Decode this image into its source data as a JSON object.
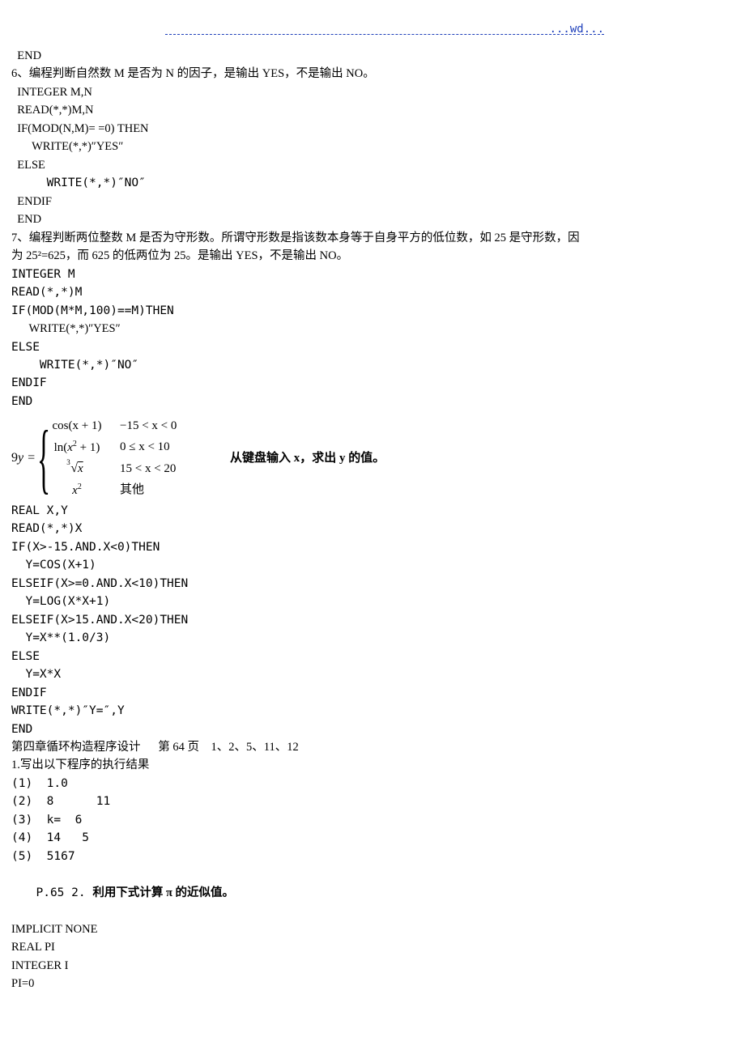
{
  "header": {
    "wd": "...wd..."
  },
  "line_end1": "  END",
  "q6_title": "6、编程判断自然数 M 是否为 N 的因子，是输出 YES，不是输出 NO。",
  "q6_l1": "  INTEGER M,N",
  "q6_l2": "  READ(*,*)M,N",
  "q6_l3": "  IF(MOD(N,M)= =0) THEN",
  "q6_l4": "       WRITE(*,*)″YES″",
  "q6_l5": "  ELSE",
  "q6_l6": "     WRITE(*,*)″NO″",
  "q6_l7": "  ENDIF",
  "q6_l8": "  END",
  "q7_title_a": "7、编程判断两位整数 M 是否为守形数。所谓守形数是指该数本身等于自身平方的低位数，如 25 是守形数，因",
  "q7_title_b": "为 25²=625，而 625 的低两位为 25。是输出 YES，不是输出 NO。",
  "q7_l1": "INTEGER M",
  "q7_l2": "READ(*,*)M",
  "q7_l3": "IF(MOD(M*M,100)==M)THEN",
  "q7_l4": "      WRITE(*,*)″YES″",
  "q7_l5": "ELSE",
  "q7_l6": "    WRITE(*,*)″NO″",
  "q7_l7": "ENDIF",
  "q7_l8": "END",
  "q9_label": "9 ",
  "q9_y_eq": "y = ",
  "piecewise": {
    "r1c1": "cos(x + 1)",
    "r1c2": "−15 < x < 0",
    "r2c1": "ln(x² + 1)",
    "r2c2": "0 ≤ x < 10",
    "r3_root_index": "3",
    "r3_root_arg": "x",
    "r3c2": "15 < x < 20",
    "r4c1": "x²",
    "r4c2": "其他"
  },
  "q9_prompt_a": "从键盘输入 ",
  "q9_prompt_x": "x",
  "q9_prompt_b": "，求出 ",
  "q9_prompt_y": "y",
  "q9_prompt_c": " 的值。",
  "q9_l1": "REAL X,Y",
  "q9_l2": "READ(*,*)X",
  "q9_l3": "IF(X>-15.AND.X<0)THEN",
  "q9_l4": "  Y=COS(X+1)",
  "q9_l5": "ELSEIF(X>=0.AND.X<10)THEN",
  "q9_l6": "  Y=LOG(X*X+1)",
  "q9_l7": "ELSEIF(X>15.AND.X<20)THEN",
  "q9_l8": "  Y=X**(1.0/3)",
  "q9_l9": "ELSE",
  "q9_l10": "  Y=X*X",
  "q9_l11": "ENDIF",
  "q9_l12": "WRITE(*,*)″Y=″,Y",
  "q9_l13": "END",
  "ch4_title": "第四章循环构造程序设计      第 64 页    1、2、5、11、12",
  "ch4_q1": "1.写出以下程序的执行结果",
  "ch4_r1": "(1)  1.0",
  "ch4_r2": "(2)  8      11",
  "ch4_r3": "(3)  k=  6",
  "ch4_r4": "(4)  14   5",
  "ch4_r5": "(5)  5167",
  "p65_label": " P.65 2. ",
  "p65_title": "利用下式计算 π 的近似值。",
  "p65_l1": "IMPLICIT NONE",
  "p65_l2": "REAL PI",
  "p65_l3": "INTEGER I",
  "p65_l4": "PI=0"
}
